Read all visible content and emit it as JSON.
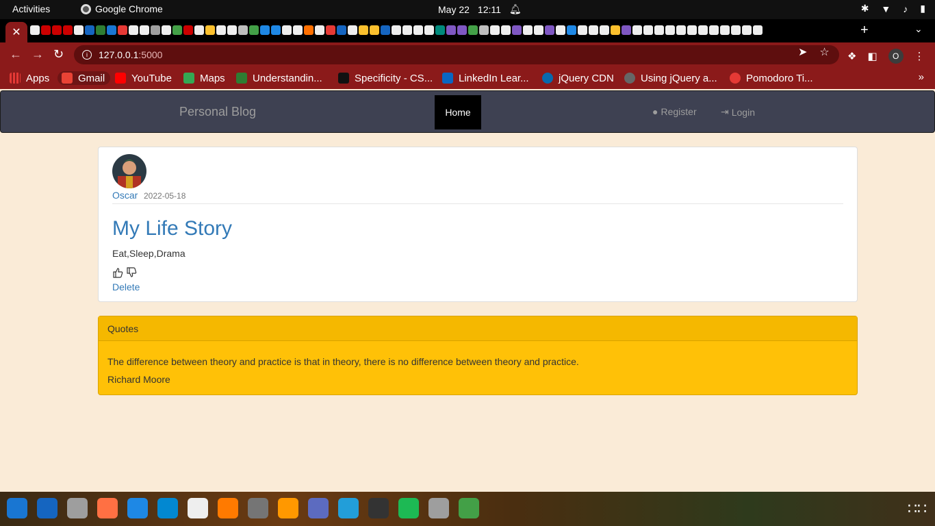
{
  "system": {
    "activities": "Activities",
    "app_name": "Google Chrome",
    "date": "May 22",
    "time": "12:11"
  },
  "browser": {
    "active_tab_close": "✕",
    "new_tab": "+",
    "url_host": "127.0.0.1",
    "url_port": ":5000",
    "profile_initial": "O",
    "bookmarks": [
      {
        "label": "Apps",
        "color": "#e53935"
      },
      {
        "label": "Gmail",
        "color": "#ea4335"
      },
      {
        "label": "YouTube",
        "color": "#ff0000"
      },
      {
        "label": "Maps",
        "color": "#34a853"
      },
      {
        "label": "Understandin...",
        "color": "#2e7d32"
      },
      {
        "label": "Specificity - CS...",
        "color": "#111111"
      },
      {
        "label": "LinkedIn Lear...",
        "color": "#0a66c2"
      },
      {
        "label": "jQuery CDN",
        "color": "#0769ad"
      },
      {
        "label": "Using jQuery a...",
        "color": "#666666"
      },
      {
        "label": "Pomodoro Ti...",
        "color": "#e53935"
      }
    ],
    "bookmarks_more": "»"
  },
  "site": {
    "brand": "Personal Blog",
    "nav": {
      "home": "Home",
      "register": "Register",
      "login": "Login"
    },
    "post": {
      "author": "Oscar",
      "date": "2022-05-18",
      "title": "My Life Story",
      "body": "Eat,Sleep,Drama",
      "delete": "Delete"
    },
    "quotes": {
      "heading": "Quotes",
      "text": "The difference between theory and practice is that in theory, there is no difference between theory and practice.",
      "author": "Richard Moore"
    }
  },
  "colors": {
    "accent_link": "#337ab7",
    "navbar_bg": "#3e4152",
    "page_bg": "#faebd7",
    "quote_bg": "#ffc107",
    "chrome_theme": "#8b1a1a"
  }
}
